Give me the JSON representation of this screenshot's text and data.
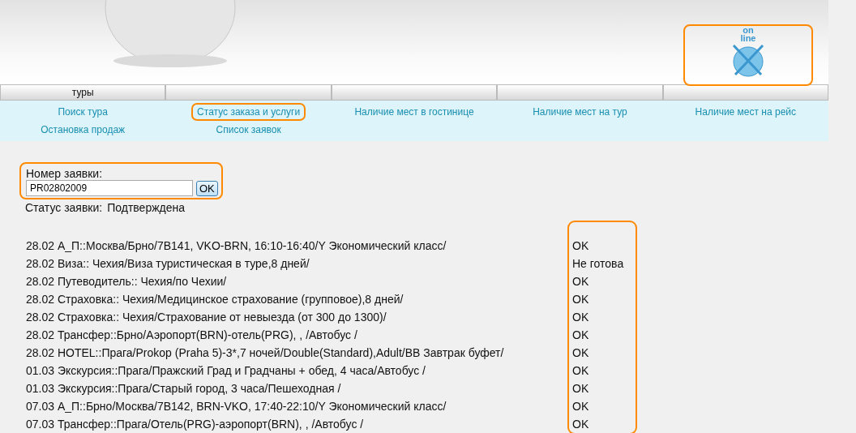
{
  "online_badge": {
    "lines": [
      "on",
      "line"
    ],
    "highlighted": true
  },
  "tabs": [
    "туры"
  ],
  "nav_rows": [
    [
      {
        "label": "Поиск тура",
        "highlighted": false
      },
      {
        "label": "Статус заказа и услуги",
        "highlighted": true
      },
      {
        "label": "Наличие мест в гостинице",
        "highlighted": false
      },
      {
        "label": "Наличие мест на тур",
        "highlighted": false
      },
      {
        "label": "Наличие мест на рейс",
        "highlighted": false
      }
    ],
    [
      {
        "label": "Остановка продаж",
        "highlighted": false
      },
      {
        "label": "Список заявок",
        "highlighted": false
      }
    ]
  ],
  "order_form": {
    "label": "Номер заявки:",
    "value": "PR02802009",
    "button": "OK",
    "highlighted": true
  },
  "order_status": {
    "label": "Статус заявки:",
    "value": "Подтверждена"
  },
  "services": [
    {
      "description": "28.02 А_П::Москва/Брно/7B141, VKO-BRN, 16:10-16:40/Y Экономический класс/",
      "status": "OK"
    },
    {
      "description": "28.02 Виза:: Чехия/Виза туристическая в туре,8 дней/",
      "status": "Не готова"
    },
    {
      "description": "28.02 Путеводитель:: Чехия/по Чехии/",
      "status": "OK"
    },
    {
      "description": "28.02 Страховка:: Чехия/Медицинское страхование (групповое),8 дней/",
      "status": "OK"
    },
    {
      "description": "28.02 Страховка:: Чехия/Страхование от невыезда (от 300 до 1300)/",
      "status": "OK"
    },
    {
      "description": "28.02 Трансфер::Брно/Аэропорт(BRN)-отель(PRG), , /Автобус /",
      "status": "OK"
    },
    {
      "description": "28.02 HOTEL::Прага/Prokop (Praha 5)-3*,7 ночей/Double(Standard),Adult/BB Завтрак буфет/",
      "status": "OK"
    },
    {
      "description": "01.03 Экскурсия::Прага/Пражский Град и Градчаны + обед, 4 часа/Автобус /",
      "status": "OK"
    },
    {
      "description": "01.03 Экскурсия::Прага/Старый город, 3 часа/Пешеходная /",
      "status": "OK"
    },
    {
      "description": "07.03 А_П::Брно/Москва/7B142, BRN-VKO, 17:40-22:10/Y Экономический класс/",
      "status": "OK"
    },
    {
      "description": "07.03 Трансфер::Прага/Отель(PRG)-аэропорт(BRN), , /Автобус /",
      "status": "OK"
    }
  ],
  "status_column_highlighted": true
}
